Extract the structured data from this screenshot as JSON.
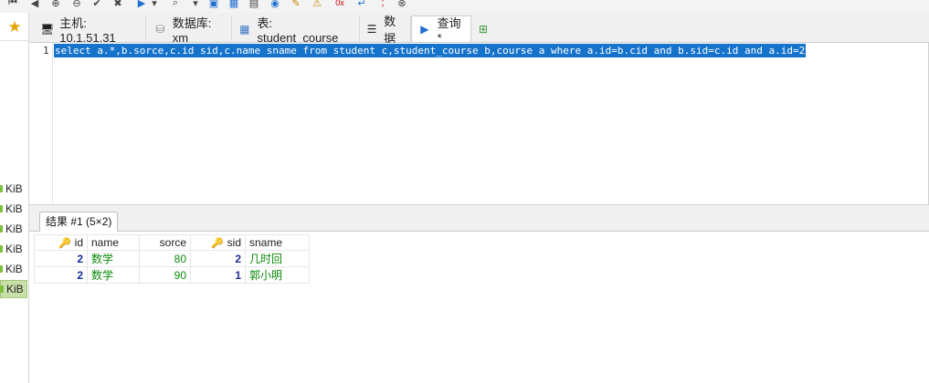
{
  "toolbar": {
    "icons": [
      "nav-first-icon",
      "nav-prev-icon",
      "add-row-icon",
      "delete-row-icon",
      "check-icon",
      "close-icon",
      "run-icon",
      "dropdown-icon",
      "search-icon",
      "dropdown-icon",
      "save-icon",
      "grid-icon",
      "table-icon",
      "users-icon",
      "edit-icon",
      "warning-icon",
      "hex-icon",
      "wrap-icon",
      "semicolon-icon",
      "stop-icon"
    ]
  },
  "left_panel": {
    "star_icon": "star-icon",
    "kib_label": "KiB",
    "kib_items": [
      "KiB",
      "KiB",
      "KiB",
      "KiB",
      "KiB",
      "KiB"
    ]
  },
  "tabs": [
    {
      "label": "主机: 10.1.51.31",
      "icon": "host-icon"
    },
    {
      "label": "数据库: xm",
      "icon": "database-icon"
    },
    {
      "label": "表: student_course",
      "icon": "table-icon"
    },
    {
      "label": "数据",
      "icon": "data-icon"
    },
    {
      "label": "查询*",
      "icon": "play-icon"
    },
    {
      "label": "",
      "icon": "new-query-icon"
    }
  ],
  "editor": {
    "line_number": "1",
    "sql": "select a.*,b.sorce,c.id sid,c.name sname from student c,student_course b,course a where a.id=b.cid and b.sid=c.id and a.id=2"
  },
  "result_tab": {
    "label": "结果 #1 (5×2)"
  },
  "grid": {
    "columns": [
      "id",
      "name",
      "sorce",
      "sid",
      "sname"
    ],
    "rows": [
      [
        "2",
        "数学",
        "80",
        "2",
        "几时回"
      ],
      [
        "2",
        "数学",
        "90",
        "1",
        "郭小明"
      ]
    ]
  },
  "colors": {
    "selection": "#1673cc",
    "number_text": "#1a2e98",
    "string_text": "#0b8a0b",
    "kib_selected": "#c8dfa9"
  }
}
